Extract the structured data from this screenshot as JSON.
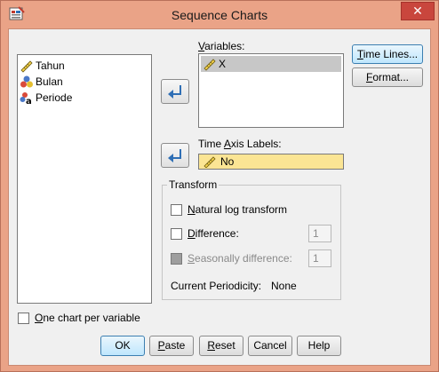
{
  "window": {
    "title": "Sequence Charts",
    "close_label": "✕",
    "app_icon": "spss-app-icon"
  },
  "source_variables": [
    {
      "label": "Tahun",
      "icon": "scale-ruler-icon"
    },
    {
      "label": "Bulan",
      "icon": "nominal-circles-icon"
    },
    {
      "label": "Periode",
      "icon": "string-a-icon"
    }
  ],
  "variables": {
    "label_mnemonic": "V",
    "label_rest": "ariables:",
    "items": [
      {
        "label": "X",
        "icon": "scale-ruler-icon"
      }
    ]
  },
  "time_axis": {
    "label_prefix": "Time ",
    "label_mnemonic": "A",
    "label_rest": "xis Labels:",
    "value": "No",
    "icon": "scale-ruler-icon"
  },
  "buttons": {
    "time_lines": {
      "mnemonic": "T",
      "rest": "ime Lines..."
    },
    "format": {
      "mnemonic": "F",
      "rest": "ormat..."
    },
    "ok": "OK",
    "paste": {
      "mnemonic": "P",
      "rest": "aste"
    },
    "reset": {
      "mnemonic": "R",
      "rest": "eset"
    },
    "cancel": "Cancel",
    "help": "Help"
  },
  "transform": {
    "legend": "Transform",
    "natural_log": {
      "mnemonic": "N",
      "rest": "atural log transform",
      "checked": false
    },
    "difference": {
      "mnemonic": "D",
      "rest": "ifference:",
      "value": "1",
      "checked": false
    },
    "seasonal": {
      "mnemonic": "S",
      "rest": "easonally difference:",
      "value": "1",
      "enabled": false
    },
    "periodicity_label": "Current Periodicity:",
    "periodicity_value": "None"
  },
  "one_chart": {
    "mnemonic": "O",
    "rest": "ne chart per variable",
    "checked": false
  },
  "colors": {
    "title_bg": "#eaa387",
    "close_bg": "#c9463d",
    "field_highlight": "#fbe594",
    "arrow_blue": "#2f6fb5"
  }
}
